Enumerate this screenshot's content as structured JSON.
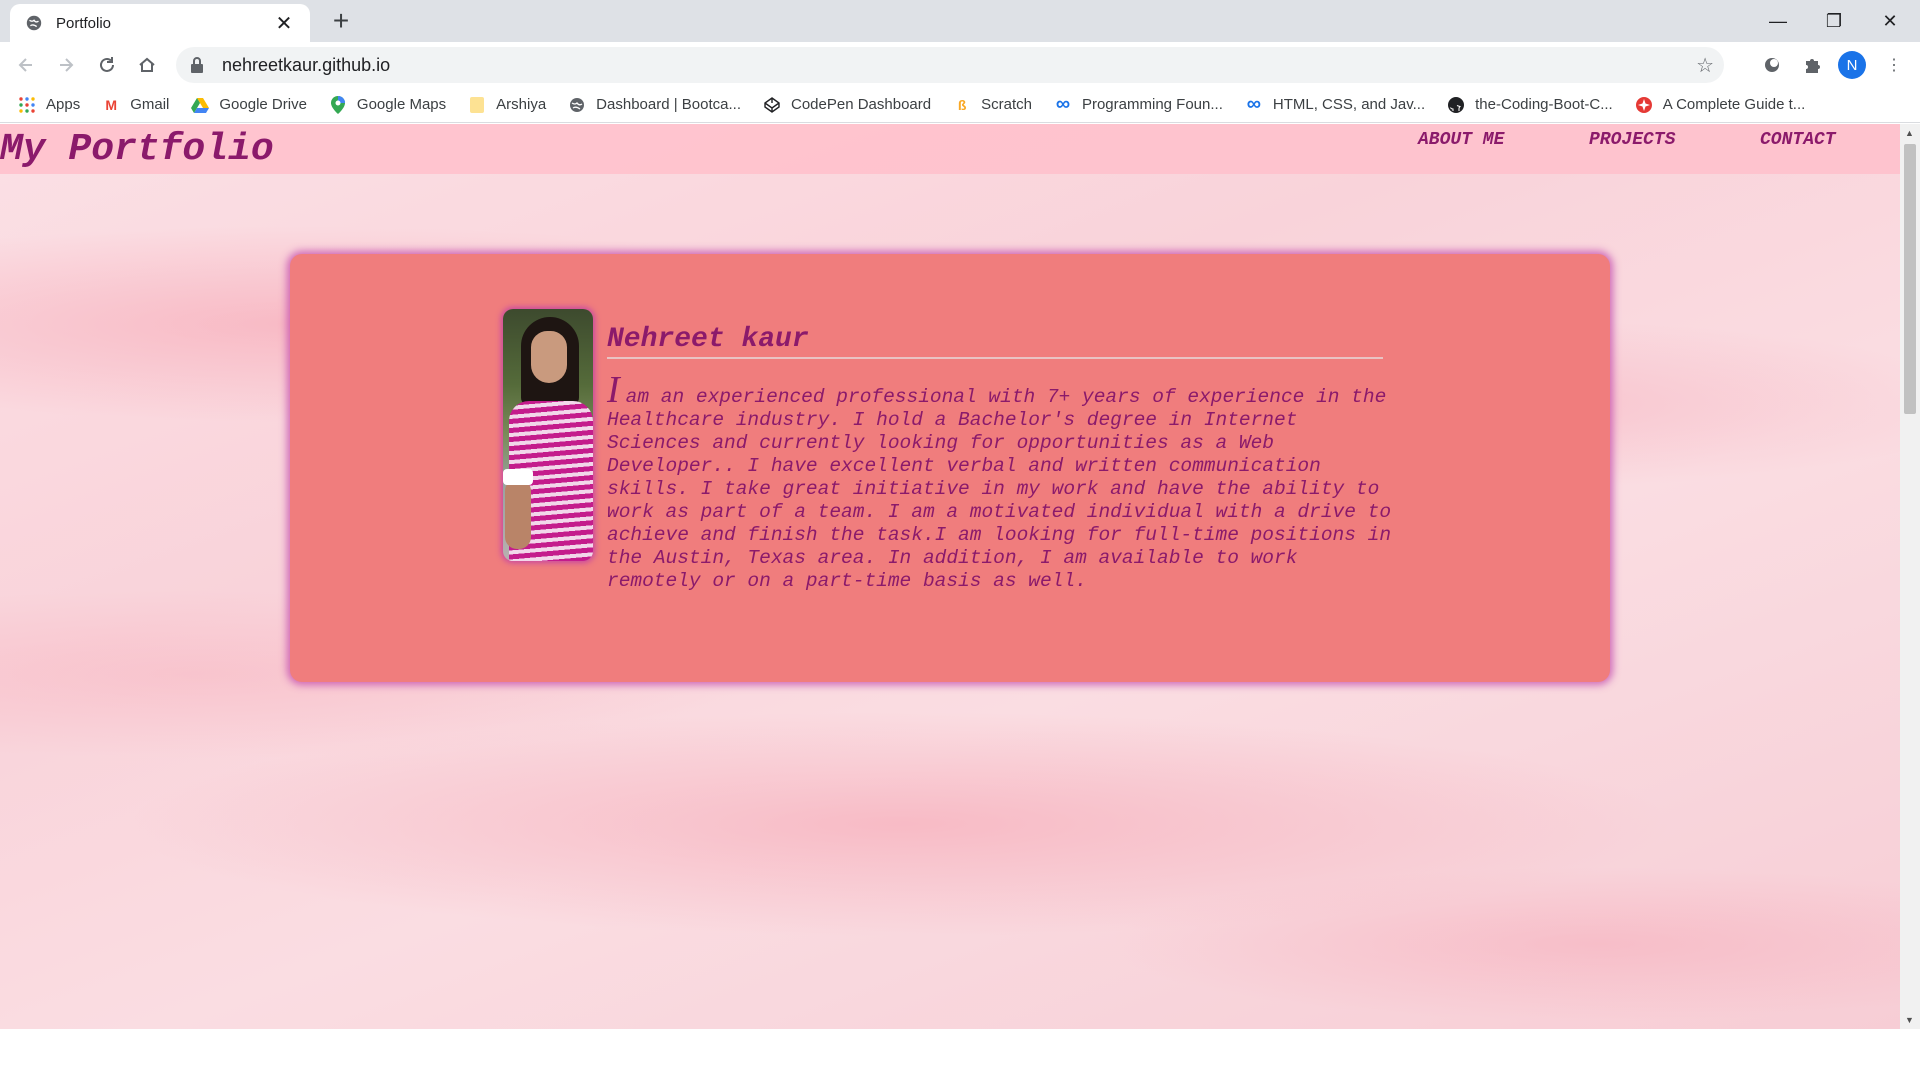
{
  "browser": {
    "tab_title": "Portfolio",
    "url": "nehreetkaur.github.io",
    "profile_initial": "N",
    "bookmarks": [
      {
        "label": "Apps",
        "icon": "apps-grid-icon"
      },
      {
        "label": "Gmail",
        "icon": "gmail-icon"
      },
      {
        "label": "Google Drive",
        "icon": "google-drive-icon"
      },
      {
        "label": "Google Maps",
        "icon": "google-maps-icon"
      },
      {
        "label": "Arshiya",
        "icon": "folder-icon"
      },
      {
        "label": "Dashboard | Bootca...",
        "icon": "globe-icon"
      },
      {
        "label": "CodePen Dashboard",
        "icon": "codepen-icon"
      },
      {
        "label": "Scratch",
        "icon": "scratch-icon"
      },
      {
        "label": "Programming Foun...",
        "icon": "infinity-icon"
      },
      {
        "label": "HTML, CSS, and Jav...",
        "icon": "infinity-icon"
      },
      {
        "label": "the-Coding-Boot-C...",
        "icon": "github-icon"
      },
      {
        "label": "A Complete Guide t...",
        "icon": "guide-icon"
      }
    ]
  },
  "site": {
    "logo": "My Portfolio",
    "nav": {
      "about": "ABOUT ME",
      "projects": "PROJECTS",
      "contact": "CONTACT"
    },
    "profile": {
      "name": "Nehreet kaur",
      "bio_first_letter": "I",
      "bio_rest": "am an experienced professional with 7+ years of experience in the Healthcare industry. I hold a Bachelor's degree in Internet Sciences and currently looking for opportunities as a Web Developer.. I have excellent verbal and written communication skills. I take great initiative in my work and have the ability to work as part of a team. I am a motivated individual with a drive to achieve and finish the task.I am looking for full-time positions in the Austin, Texas area. In addition, I am available to work remotely or on a part-time basis as well."
    }
  },
  "colors": {
    "accent": "#8b1a6b",
    "card": "#f07d7d",
    "header": "#ffc0cb"
  }
}
